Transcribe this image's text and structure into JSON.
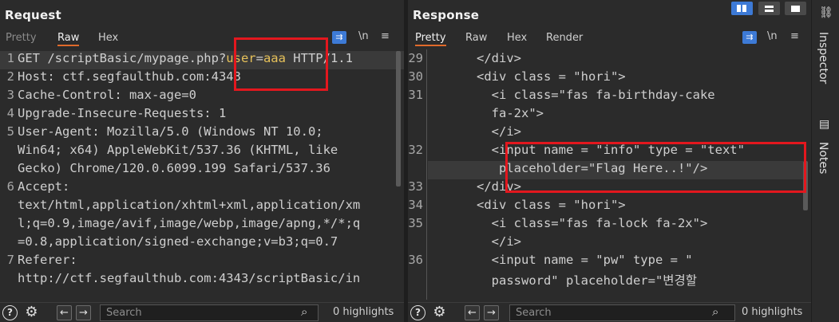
{
  "request": {
    "title": "Request",
    "tabs": [
      "Pretty",
      "Raw",
      "Hex"
    ],
    "active_tab": "Raw",
    "tool_newline": "\\n",
    "tool_menu": "≡",
    "lines": [
      {
        "n": "1",
        "rows": [
          "GET /scriptBasic/mypage.php?user=aaa HTTP/1.1"
        ]
      },
      {
        "n": "2",
        "rows": [
          "Host: ctf.segfaulthub.com:4343"
        ]
      },
      {
        "n": "3",
        "rows": [
          "Cache-Control: max-age=0"
        ]
      },
      {
        "n": "4",
        "rows": [
          "Upgrade-Insecure-Requests: 1"
        ]
      },
      {
        "n": "5",
        "rows": [
          "User-Agent: Mozilla/5.0 (Windows NT 10.0;",
          "Win64; x64) AppleWebKit/537.36 (KHTML, like",
          "Gecko) Chrome/120.0.6099.199 Safari/537.36"
        ]
      },
      {
        "n": "6",
        "rows": [
          "Accept:",
          "text/html,application/xhtml+xml,application/xm",
          "l;q=0.9,image/avif,image/webp,image/apng,*/*;q",
          "=0.8,application/signed-exchange;v=b3;q=0.7"
        ]
      },
      {
        "n": "7",
        "rows": [
          "Referer:",
          "http://ctf.segfaulthub.com:4343/scriptBasic/in"
        ]
      }
    ],
    "line1_parts": {
      "pre": "GET /scriptBasic/mypage.php?",
      "k": "user",
      "eq": "=",
      "v": "aaa",
      "post": " HTTP/1.1"
    },
    "search_placeholder": "Search",
    "highlights": "0 highlights"
  },
  "response": {
    "title": "Response",
    "tabs": [
      "Pretty",
      "Raw",
      "Hex",
      "Render"
    ],
    "active_tab": "Pretty",
    "tool_newline": "\\n",
    "tool_menu": "≡",
    "lines": [
      {
        "n": "29",
        "rows": [
          "      </div>"
        ]
      },
      {
        "n": "30",
        "rows": [
          "      <div class = \"hori\">"
        ]
      },
      {
        "n": "31",
        "rows": [
          "        <i class=\"fas fa-birthday-cake",
          "        fa-2x\">",
          "        </i>"
        ]
      },
      {
        "n": "32",
        "rows": [
          "        <input name = \"info\" type = \"text\"",
          "         placeholder=\"Flag Here..!\"/>"
        ]
      },
      {
        "n": "33",
        "rows": [
          "      </div>"
        ]
      },
      {
        "n": "34",
        "rows": [
          "      <div class = \"hori\">"
        ]
      },
      {
        "n": "35",
        "rows": [
          "        <i class=\"fas fa-lock fa-2x\">",
          "        </i>"
        ]
      },
      {
        "n": "36",
        "rows": [
          "        <input name = \"pw\" type = \"",
          "        password\" placeholder=\"변경할"
        ]
      }
    ],
    "search_placeholder": "Search",
    "highlights": "0 highlights"
  },
  "sidebar": {
    "inspector": "Inspector",
    "notes": "Notes"
  },
  "footer_icons": {
    "help": "?",
    "settings": "⚙",
    "back": "←",
    "forward": "→",
    "search": "⌕"
  }
}
